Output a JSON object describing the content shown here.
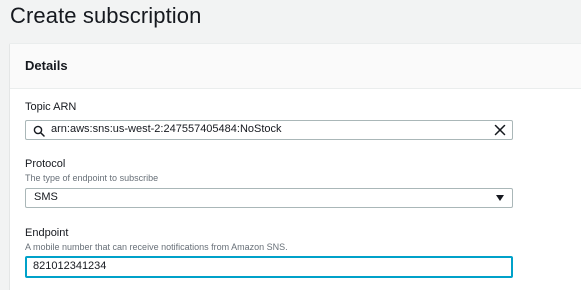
{
  "page": {
    "title": "Create subscription"
  },
  "details": {
    "title": "Details",
    "topic_arn": {
      "label": "Topic ARN",
      "value": "arn:aws:sns:us-west-2:247557405484:NoStock",
      "search_icon": "search-icon",
      "clear_icon": "close-icon"
    },
    "protocol": {
      "label": "Protocol",
      "description": "The type of endpoint to subscribe",
      "selected": "SMS",
      "dropdown_icon": "caret-down-icon"
    },
    "endpoint": {
      "label": "Endpoint",
      "description": "A mobile number that can receive notifications from Amazon SNS.",
      "value": "821012341234"
    }
  }
}
